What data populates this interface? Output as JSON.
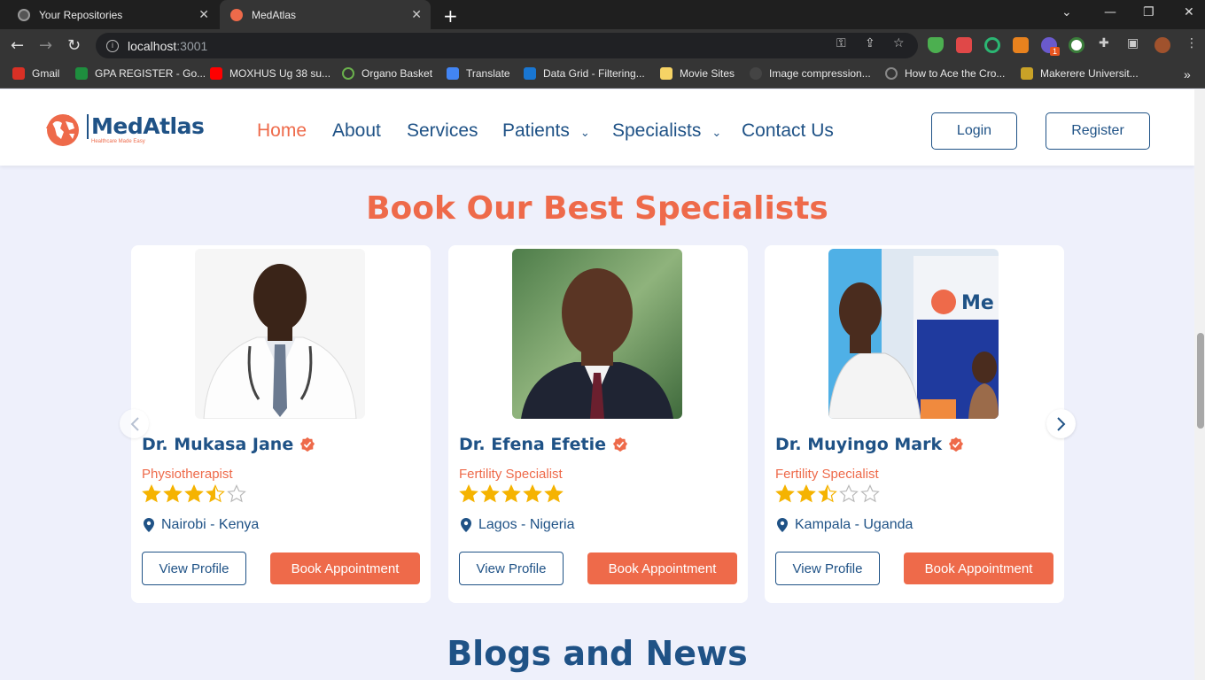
{
  "browser": {
    "tabs": [
      {
        "title": "Your Repositories",
        "active": false
      },
      {
        "title": "MedAtlas",
        "active": true
      }
    ],
    "url_host": "localhost",
    "url_port": ":3001",
    "bookmarks": [
      {
        "label": "Gmail",
        "icon": "gmail-icon"
      },
      {
        "label": "GPA REGISTER - Go...",
        "icon": "sheets-icon"
      },
      {
        "label": "MOXHUS Ug 38 su...",
        "icon": "youtube-icon"
      },
      {
        "label": "Organo Basket",
        "icon": "organo-icon"
      },
      {
        "label": "Translate",
        "icon": "translate-icon"
      },
      {
        "label": "Data Grid - Filtering...",
        "icon": "mui-icon"
      },
      {
        "label": "Movie Sites",
        "icon": "folder-icon"
      },
      {
        "label": "Image compression...",
        "icon": "github-icon"
      },
      {
        "label": "How to Ace the Cro...",
        "icon": "eye-icon"
      },
      {
        "label": "Makerere Universit...",
        "icon": "crest-icon"
      }
    ],
    "extension_badge": "1"
  },
  "site": {
    "logo_name": "MedAtlas",
    "logo_tagline": "Healthcare Made Easy",
    "nav": {
      "home": "Home",
      "about": "About",
      "services": "Services",
      "patients": "Patients",
      "specialists": "Specialists",
      "contact": "Contact Us"
    },
    "login": "Login",
    "register": "Register"
  },
  "section": {
    "title": "Book Our Best Specialists",
    "doctors": [
      {
        "name": "Dr. Mukasa Jane",
        "specialty": "Physiotherapist",
        "rating": 3.5,
        "location": "Nairobi - Kenya",
        "view_label": "View Profile",
        "book_label": "Book Appointment"
      },
      {
        "name": "Dr. Efena Efetie",
        "specialty": "Fertility Specialist",
        "rating": 5,
        "location": "Lagos - Nigeria",
        "view_label": "View Profile",
        "book_label": "Book Appointment"
      },
      {
        "name": "Dr. Muyingo Mark",
        "specialty": "Fertility Specialist",
        "rating": 2.5,
        "location": "Kampala - Uganda",
        "view_label": "View Profile",
        "book_label": "Book Appointment"
      }
    ]
  },
  "blogs": {
    "title": "Blogs and News"
  },
  "colors": {
    "brand_blue": "#1f5286",
    "accent": "#ee6a4a",
    "star": "#f5b301",
    "page_bg": "#eef0fb"
  }
}
